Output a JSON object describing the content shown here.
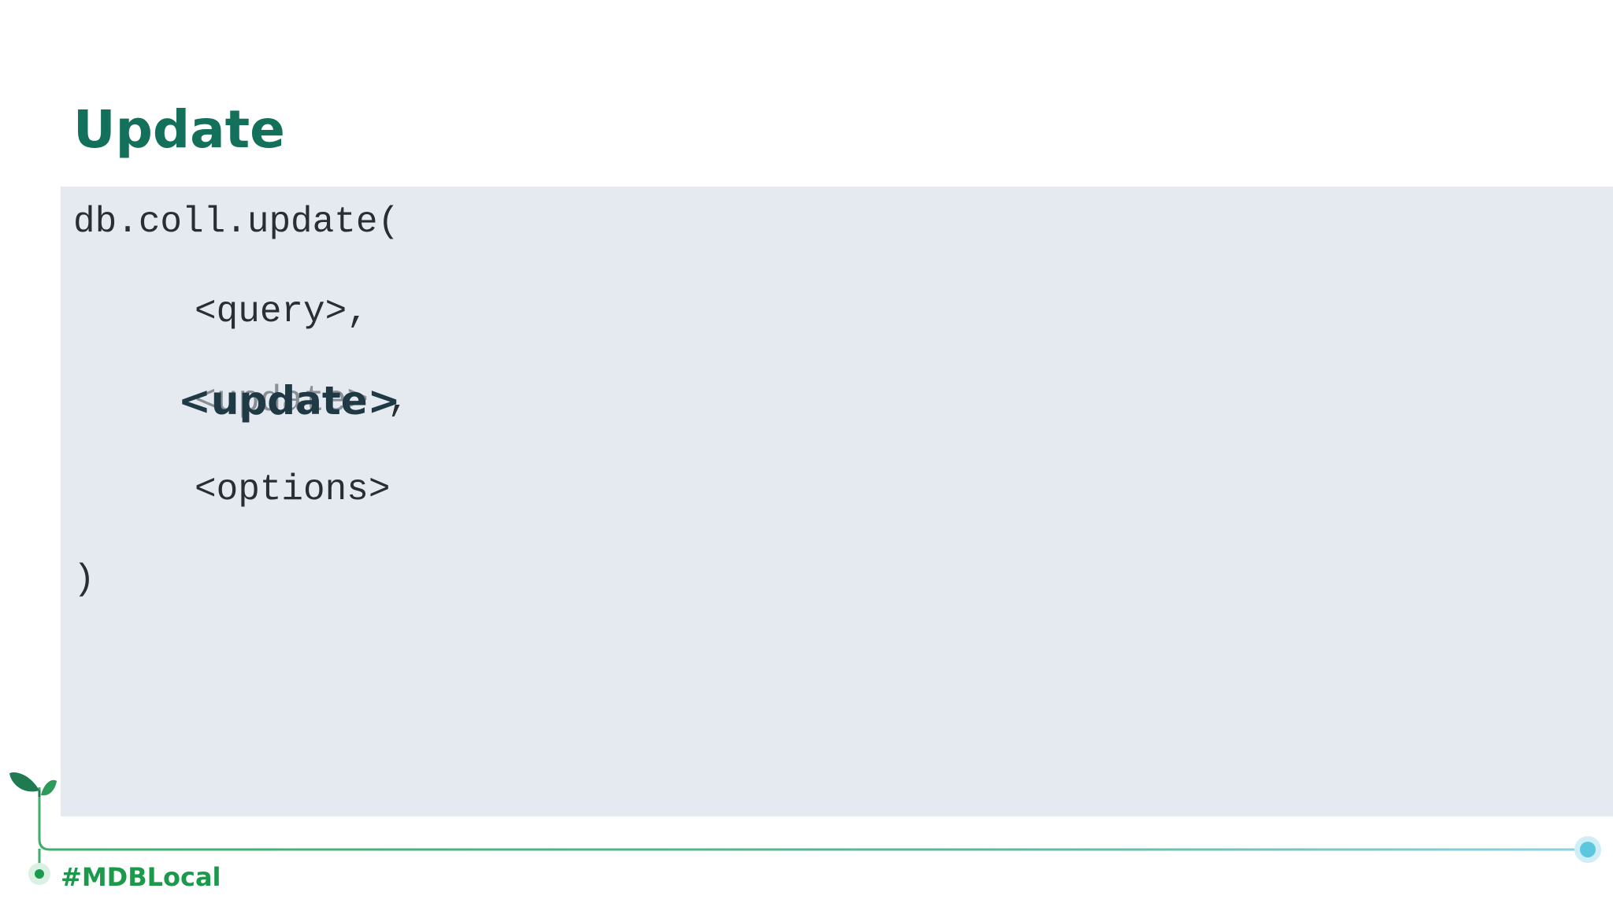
{
  "slide": {
    "title": "Update",
    "code_lines": [
      "db.coll.update(",
      "<query>,",
      "<update>",
      "<options>",
      ")"
    ],
    "highlight_overlay": "<update>",
    "highlight_trailing": ",",
    "hashtag": "#MDBLocal"
  },
  "colors": {
    "title": "#13705a",
    "code_background": "#e5eaf0",
    "code_text": "#2a2e33",
    "overlay_text": "#1f3a45",
    "brand_green": "#1a9a4a",
    "timeline_end": "#5bc8e0"
  },
  "icons": [
    "sprout-leaves-icon",
    "timeline-node-icon",
    "timeline-end-dot-icon"
  ]
}
